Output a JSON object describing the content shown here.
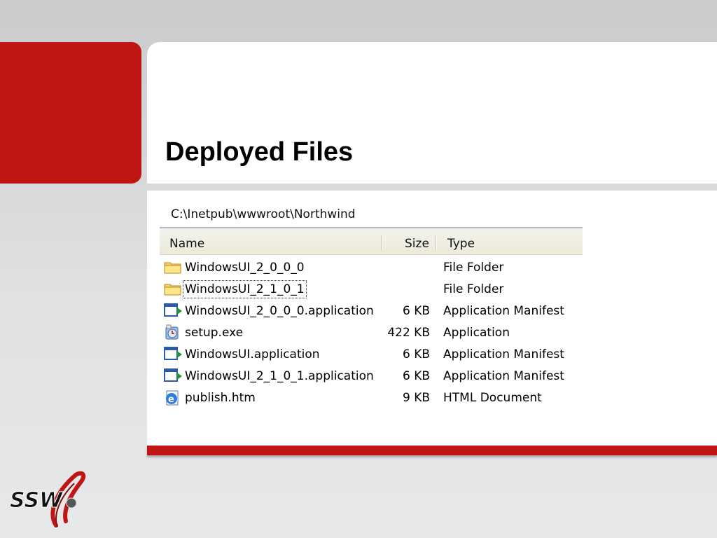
{
  "slide": {
    "title": "Deployed Files"
  },
  "explorer": {
    "path": "C:\\Inetpub\\wwwroot\\Northwind",
    "columns": {
      "name": "Name",
      "size": "Size",
      "type": "Type"
    },
    "rows": [
      {
        "name": "WindowsUI_2_0_0_0",
        "size": "",
        "type": "File Folder",
        "icon": "folder-icon"
      },
      {
        "name": "WindowsUI_2_1_0_1",
        "size": "",
        "type": "File Folder",
        "icon": "folder-icon",
        "focused": true
      },
      {
        "name": "WindowsUI_2_0_0_0.application",
        "size": "6 KB",
        "type": "Application Manifest",
        "icon": "application-manifest-icon"
      },
      {
        "name": "setup.exe",
        "size": "422 KB",
        "type": "Application",
        "icon": "setup-exe-icon"
      },
      {
        "name": "WindowsUI.application",
        "size": "6 KB",
        "type": "Application Manifest",
        "icon": "application-manifest-icon"
      },
      {
        "name": "WindowsUI_2_1_0_1.application",
        "size": "6 KB",
        "type": "Application Manifest",
        "icon": "application-manifest-icon"
      },
      {
        "name": "publish.htm",
        "size": "9 KB",
        "type": "HTML Document",
        "icon": "html-document-icon"
      }
    ]
  },
  "logo": {
    "text": "SSW",
    "icon": "ssw-logo"
  },
  "colors": {
    "accent_red": "#c01515",
    "header_bg": "#ebeadb"
  }
}
